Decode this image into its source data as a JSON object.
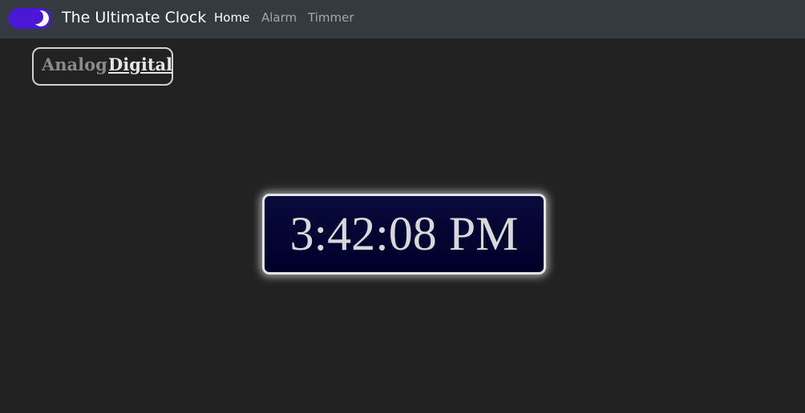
{
  "navbar": {
    "theme_toggle": {
      "state": "dark",
      "icon": "moon-icon",
      "color": "#4a17d6"
    },
    "brand": "The Ultimate Clock",
    "links": [
      {
        "label": "Home",
        "active": true
      },
      {
        "label": "Alarm",
        "active": false
      },
      {
        "label": "Timmer",
        "active": false
      }
    ]
  },
  "mode_switch": {
    "options": [
      "Analog",
      "Digital"
    ],
    "selected": "Digital"
  },
  "clock": {
    "time": "3:42:08 PM"
  },
  "colors": {
    "background": "#222222",
    "navbar": "#343a40",
    "clock_face": "#00002a"
  }
}
